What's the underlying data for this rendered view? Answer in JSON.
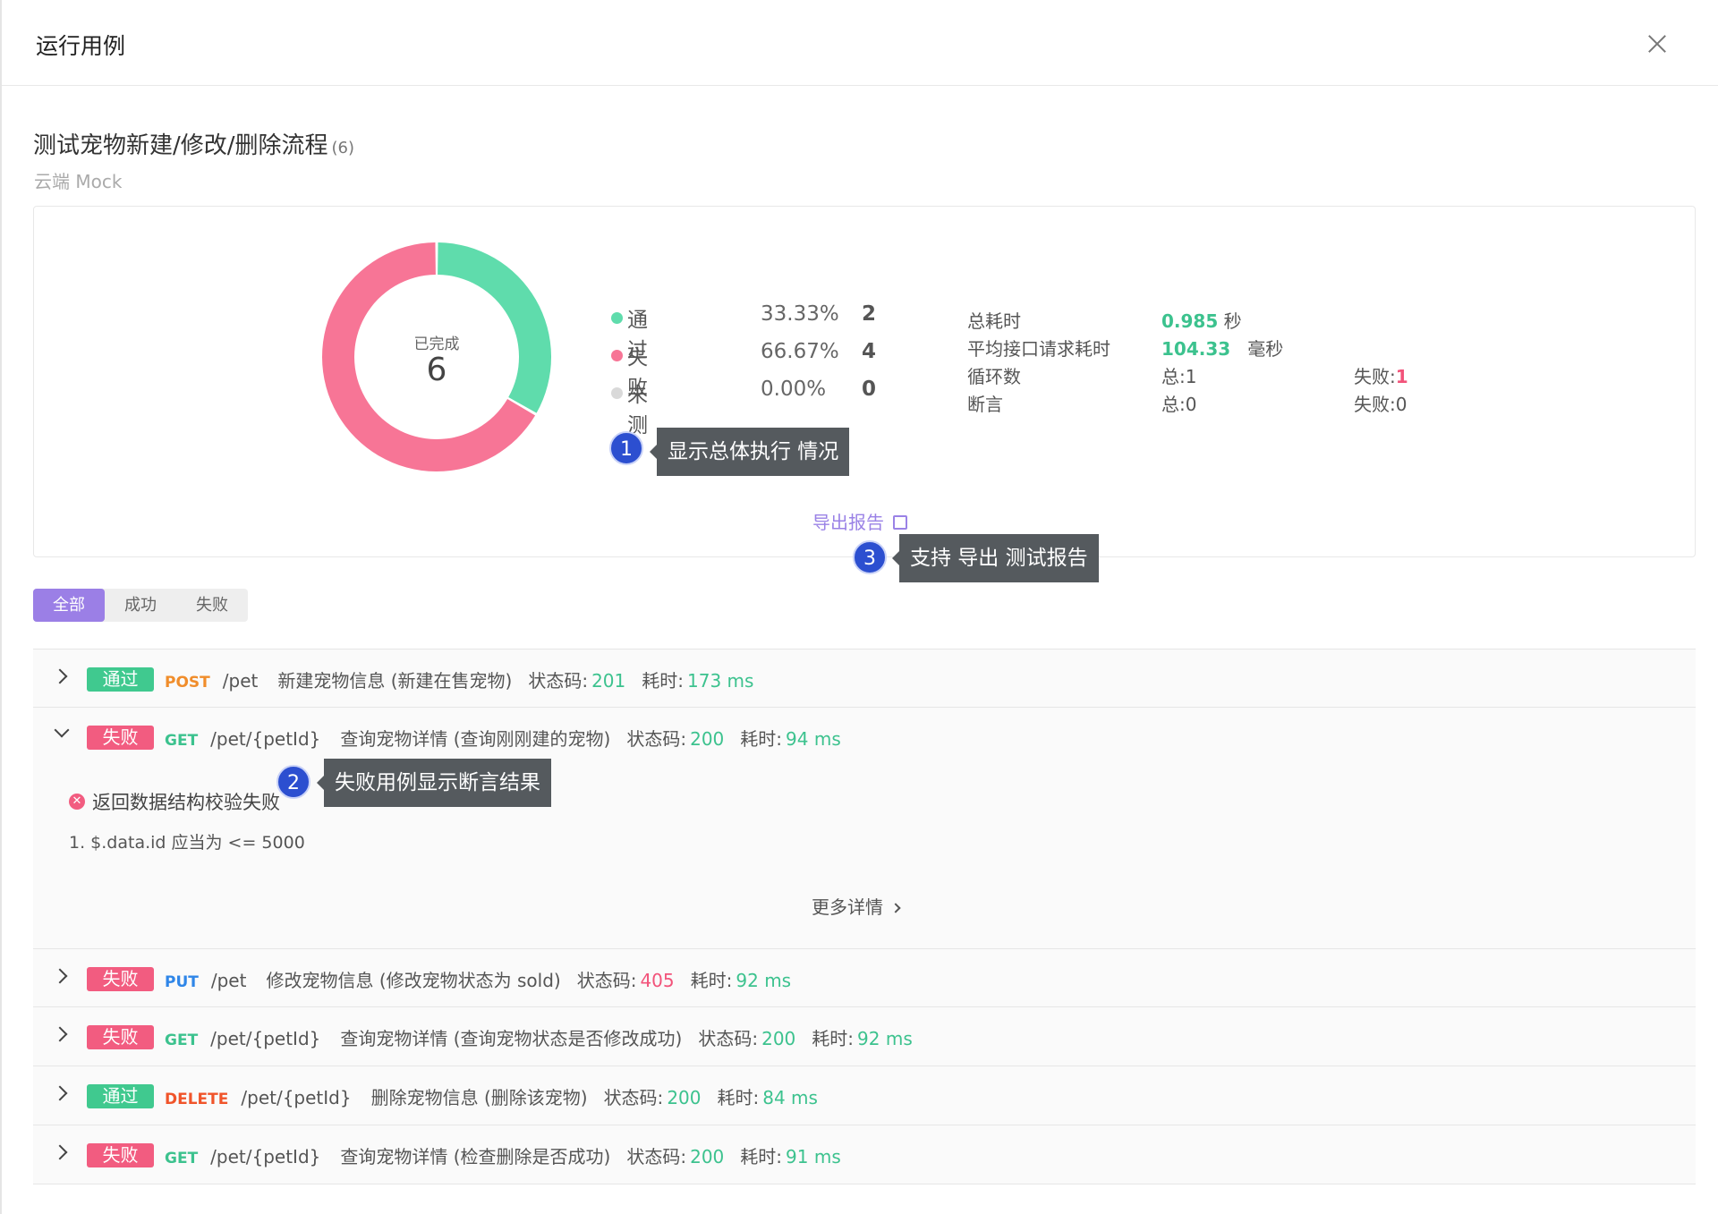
{
  "modal": {
    "title": "运行用例"
  },
  "collection": {
    "name": "测试宠物新建/修改/删除流程",
    "count": "(6)",
    "environment": "云端 Mock"
  },
  "summary": {
    "center_label": "已完成",
    "center_value": "6",
    "legend": [
      {
        "label": "通过",
        "percent": "33.33%",
        "count": "2",
        "color": "#5fdcac"
      },
      {
        "label": "失败",
        "percent": "66.67%",
        "count": "4",
        "color": "#f77596"
      },
      {
        "label": "未测",
        "percent": "0.00%",
        "count": "0",
        "color": "#d9d9d9"
      }
    ],
    "stats": {
      "total_time_label": "总耗时",
      "total_time_value": "0.985",
      "total_time_unit": "秒",
      "avg_label": "平均接口请求耗时",
      "avg_value": "104.33",
      "avg_unit": "毫秒",
      "loop_label": "循环数",
      "loop_total": "总:1",
      "loop_fail_label": "失败:",
      "loop_fail_value": "1",
      "assert_label": "断言",
      "assert_total": "总:0",
      "assert_fail": "失败:0"
    },
    "export_label": "导出报告"
  },
  "chart_data": {
    "type": "pie",
    "categories": [
      "通过",
      "失败",
      "未测"
    ],
    "values": [
      2,
      4,
      0
    ],
    "colors": [
      "#5fdcac",
      "#f77596",
      "#d9d9d9"
    ]
  },
  "callouts": [
    {
      "num": "1",
      "text": "显示总体执行 情况"
    },
    {
      "num": "2",
      "text": "失败用例显示断言结果"
    },
    {
      "num": "3",
      "text": "支持 导出 测试报告"
    }
  ],
  "filters": {
    "all": "全部",
    "success": "成功",
    "fail": "失败"
  },
  "cases": [
    {
      "status": "通过",
      "method": "POST",
      "path": "/pet",
      "name": "新建宠物信息 (新建在售宠物)",
      "code_label": "状态码:",
      "code": "201",
      "time_label": "耗时:",
      "time": "173 ms"
    },
    {
      "status": "失败",
      "method": "GET",
      "path": "/pet/{petId}",
      "name": "查询宠物详情 (查询刚刚建的宠物)",
      "code_label": "状态码:",
      "code": "200",
      "time_label": "耗时:",
      "time": "94 ms"
    },
    {
      "status": "失败",
      "method": "PUT",
      "path": "/pet",
      "name": "修改宠物信息 (修改宠物状态为 sold)",
      "code_label": "状态码:",
      "code": "405",
      "time_label": "耗时:",
      "time": "92 ms"
    },
    {
      "status": "失败",
      "method": "GET",
      "path": "/pet/{petId}",
      "name": "查询宠物详情 (查询宠物状态是否修改成功)",
      "code_label": "状态码:",
      "code": "200",
      "time_label": "耗时:",
      "time": "92 ms"
    },
    {
      "status": "通过",
      "method": "DELETE",
      "path": "/pet/{petId}",
      "name": "删除宠物信息 (删除该宠物)",
      "code_label": "状态码:",
      "code": "200",
      "time_label": "耗时:",
      "time": "84 ms"
    },
    {
      "status": "失败",
      "method": "GET",
      "path": "/pet/{petId}",
      "name": "查询宠物详情 (检查删除是否成功)",
      "code_label": "状态码:",
      "code": "200",
      "time_label": "耗时:",
      "time": "91 ms"
    }
  ],
  "detail": {
    "error_title": "返回数据结构校验失败",
    "error_item": "1. $.data.id 应当为 <= 5000",
    "more_label": "更多详情"
  }
}
